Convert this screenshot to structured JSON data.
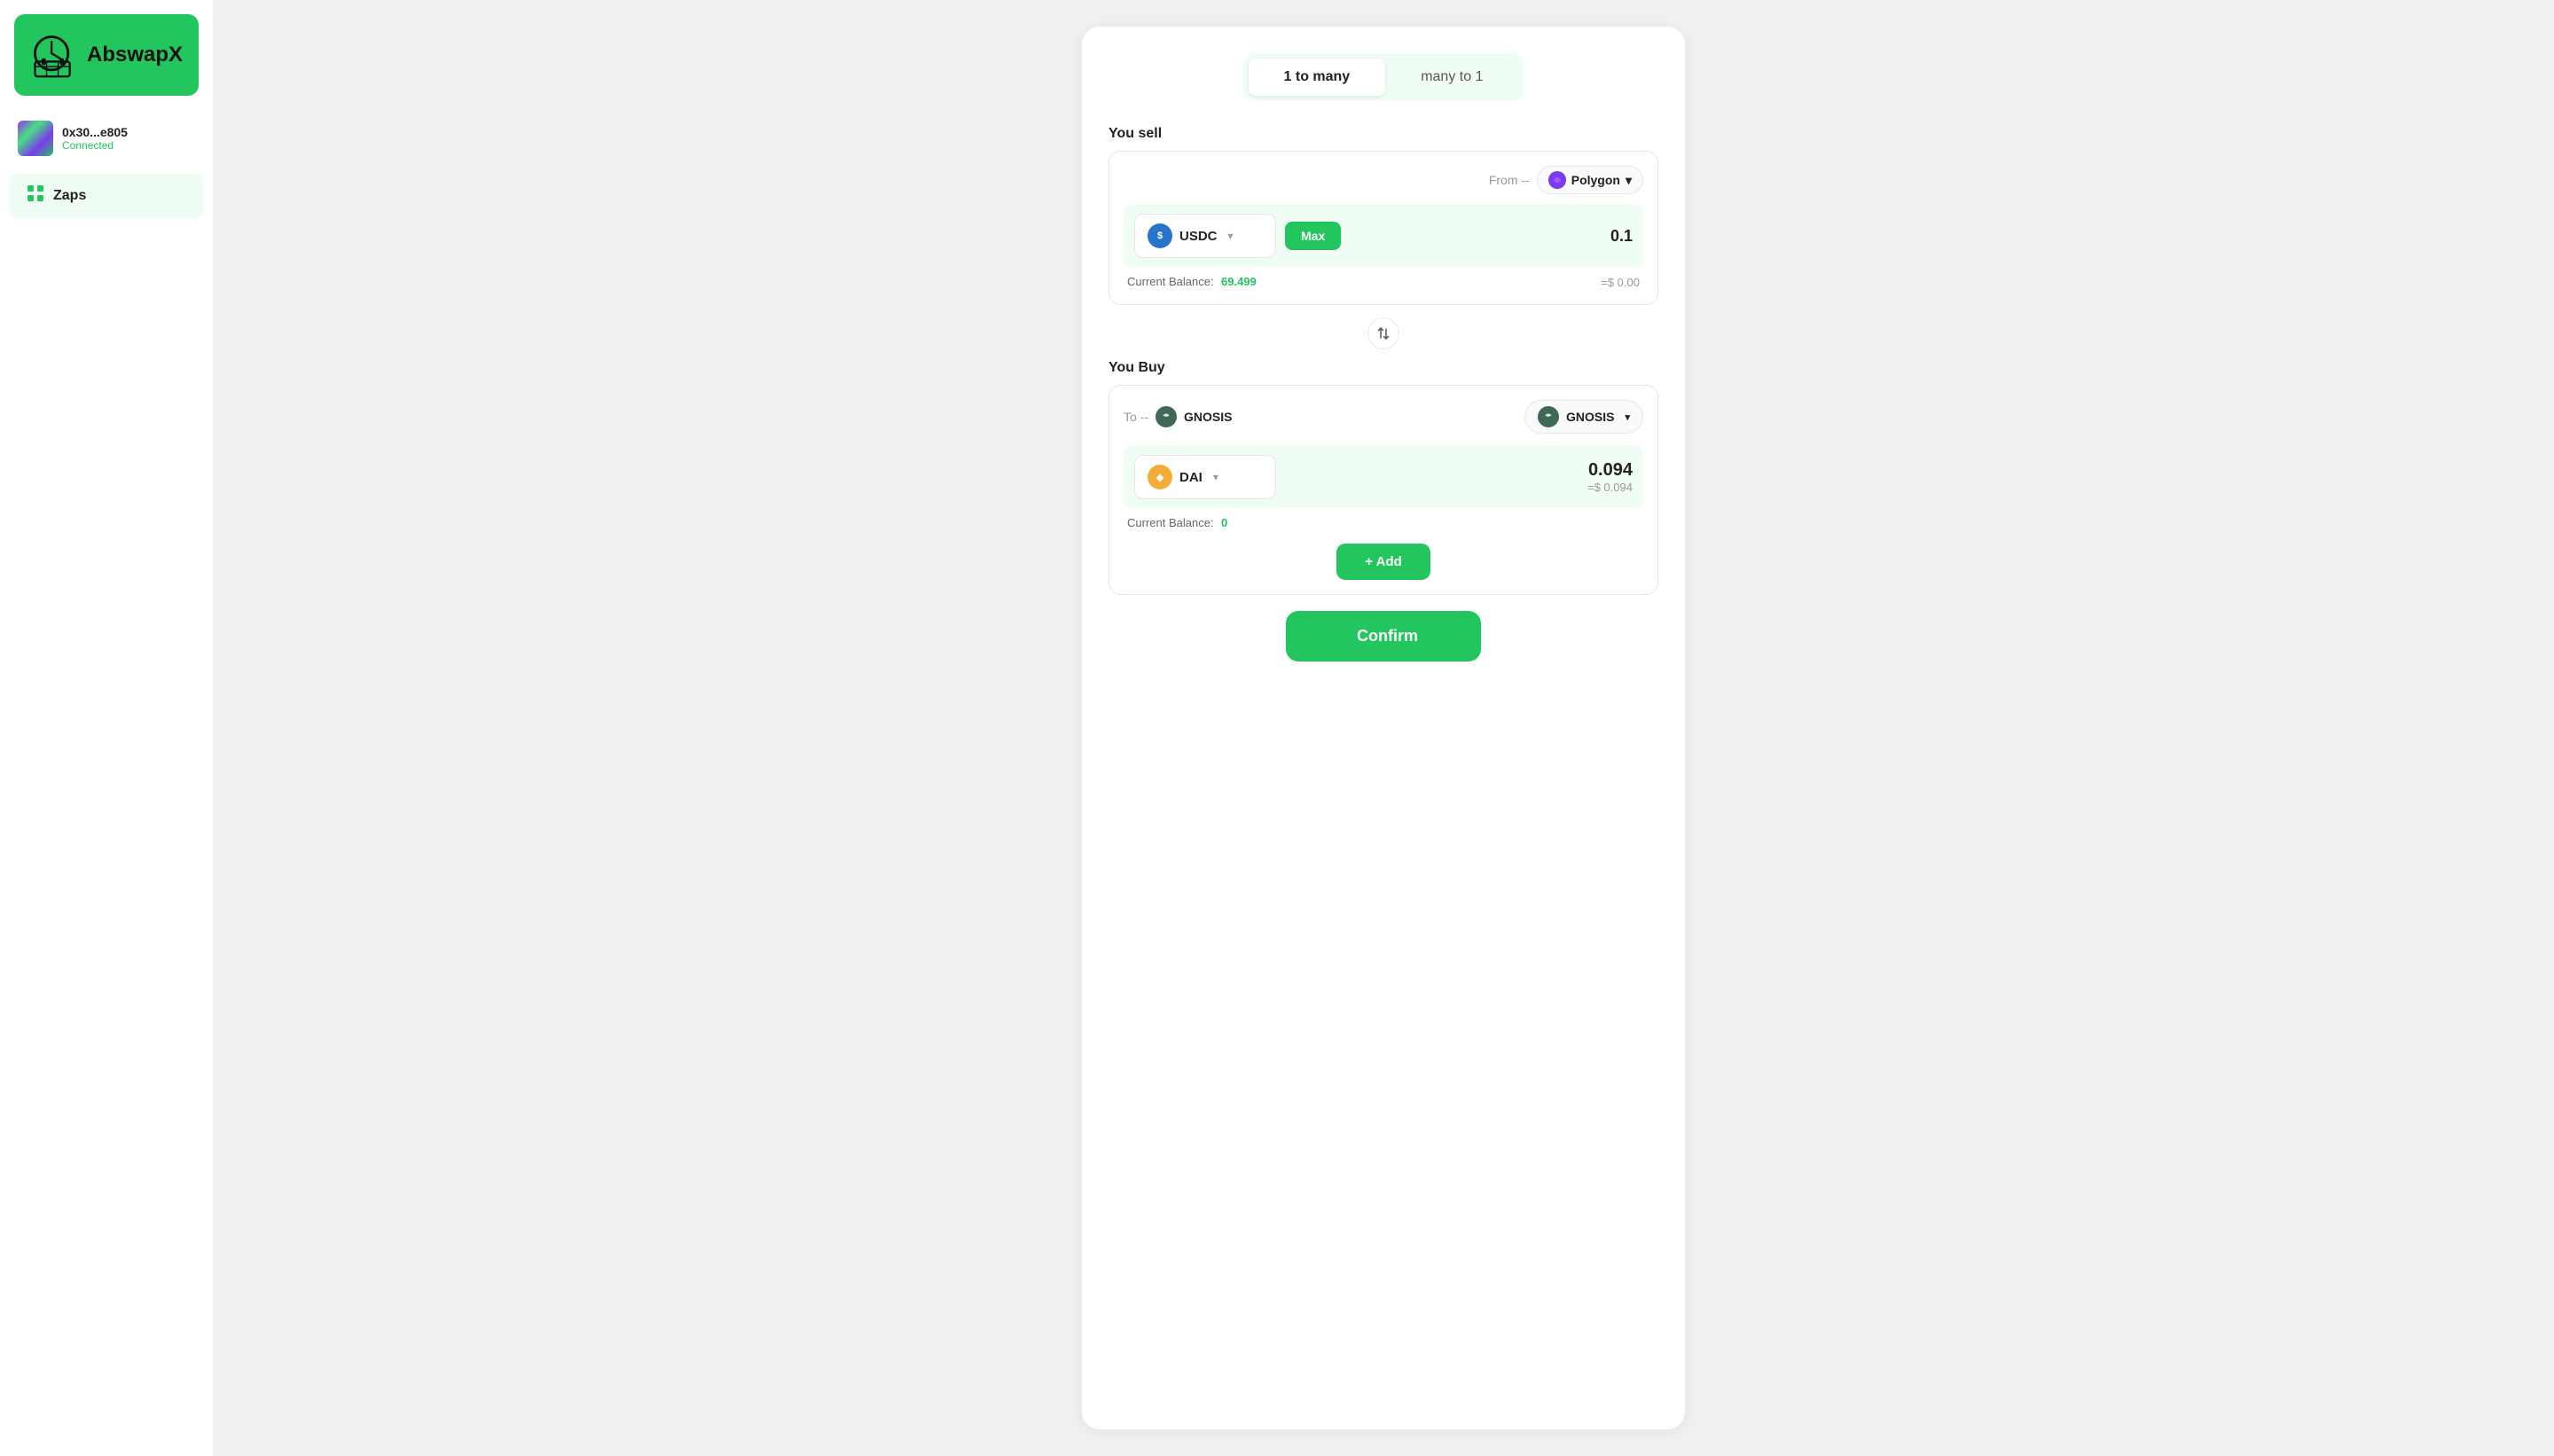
{
  "sidebar": {
    "logo_text": "AbswapX",
    "wallet_address": "0x30...e805",
    "wallet_status": "Connected",
    "nav_items": [
      {
        "label": "Zaps",
        "icon": "grid"
      }
    ]
  },
  "page": {
    "tabs": [
      {
        "label": "1 to many",
        "active": true
      },
      {
        "label": "many to 1",
        "active": false
      }
    ],
    "sell_section": {
      "title": "You sell",
      "from_label": "From --",
      "network": "Polygon",
      "token": "USDC",
      "max_btn": "Max",
      "amount": "0.1",
      "balance_label": "Current Balance:",
      "balance_value": "69.499",
      "usd_value": "=$ 0.00"
    },
    "buy_section": {
      "title": "You Buy",
      "to_label": "To --",
      "to_network": "GNOSIS",
      "dest_network": "GNOSIS",
      "token": "DAI",
      "amount": "0.094",
      "usd_value": "=$ 0.094",
      "balance_label": "Current Balance:",
      "balance_value": "0",
      "add_btn": "+ Add"
    },
    "confirm_btn": "Confirm"
  }
}
